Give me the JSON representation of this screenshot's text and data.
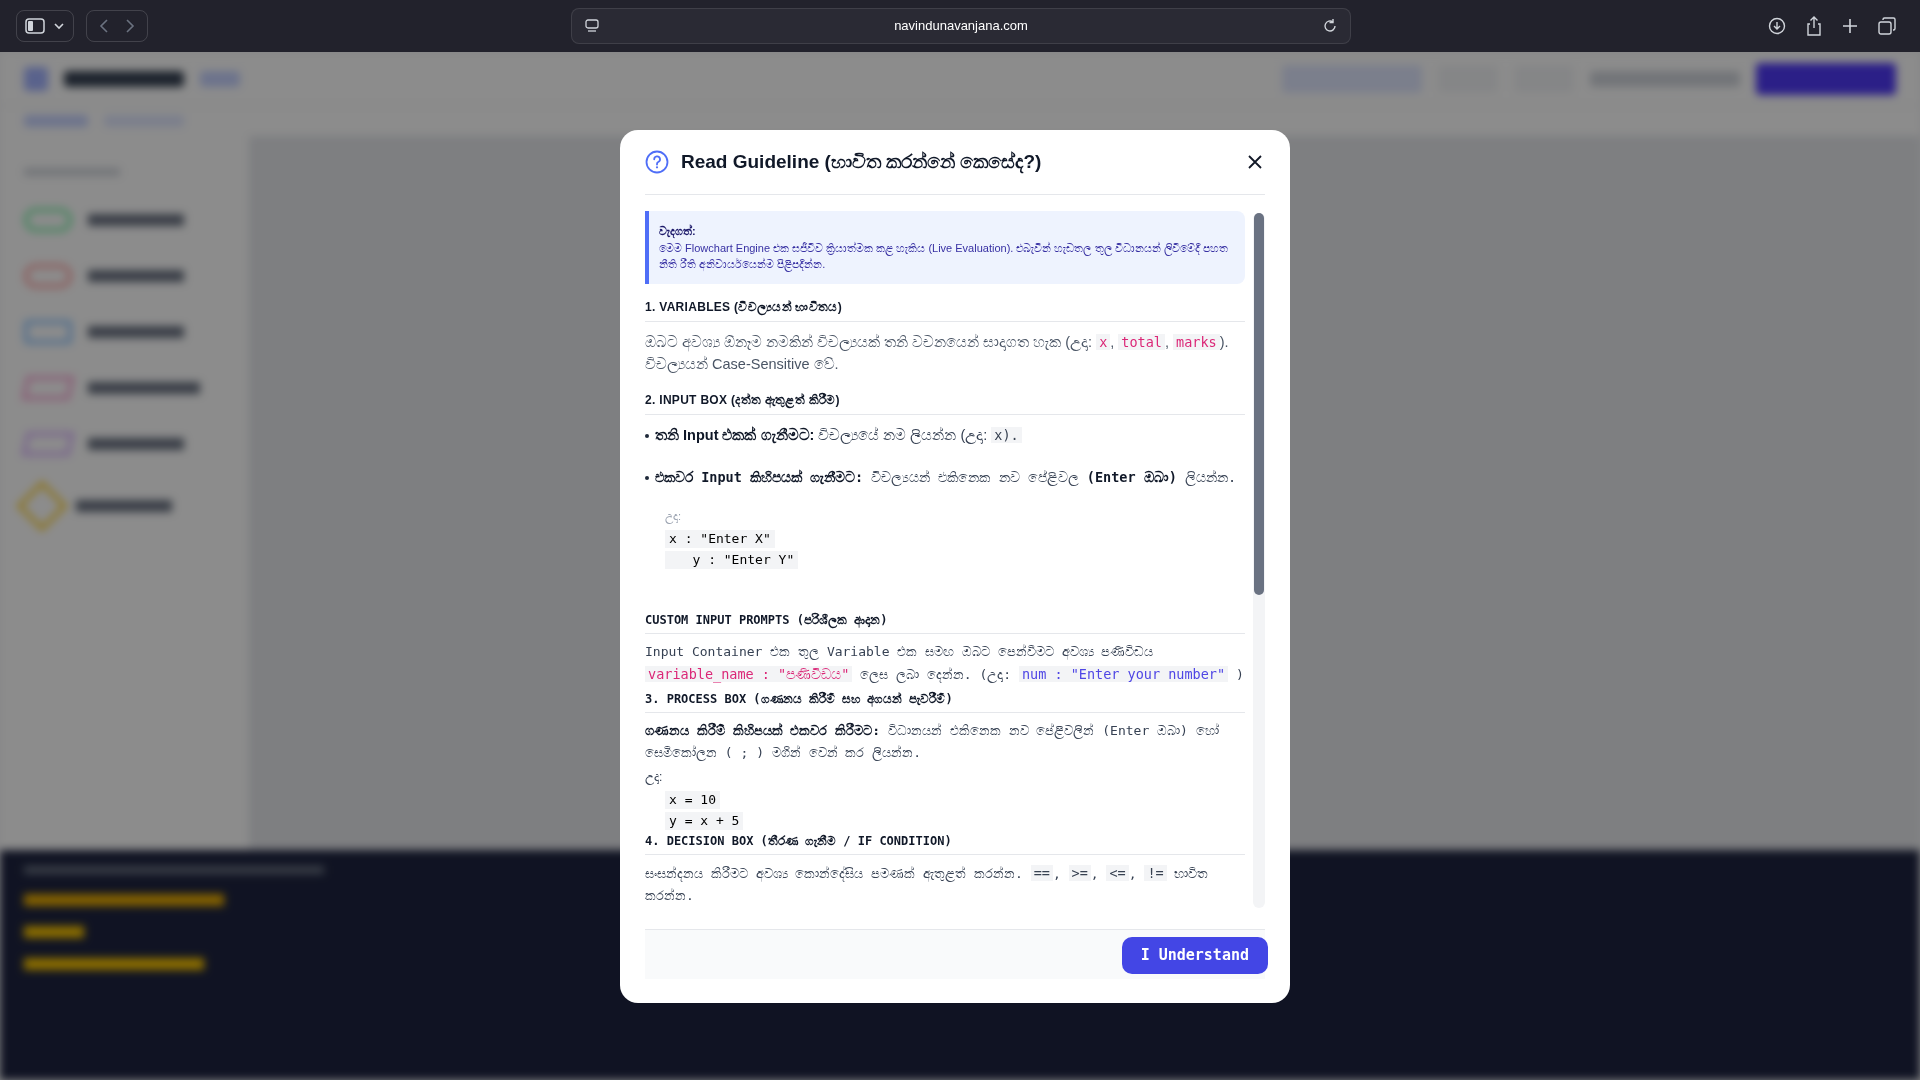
{
  "browser": {
    "url": "navindunavanjana.com"
  },
  "modal": {
    "title": "Read Guideline (භාවිත කරන්නේ කෙසේද?)",
    "note": {
      "heading": "වැදගත්:",
      "text": "මෙම Flowchart Engine එක සජීවීව ක්‍රියාත්මක කළ හැකිය (Live Evaluation). එබැවින් හැඩතල තුල විධානයන් ලිවීමේදී පහත නීති රීති අනිවාර්යයෙන්ම පිළිපදින්න."
    },
    "blocks": [
      {
        "kind": "heading",
        "text": "1. VARIABLES (විචල්‍යයන් භාවිතය)"
      },
      {
        "kind": "paragraph",
        "parts": [
          {
            "kind": "text",
            "text": "ඔබට අවශ්‍ය ඕනෑම නමකින් විචල්‍යයක් තනි වචනයෙන් සාදාගත හැක (උදා: "
          },
          {
            "kind": "code",
            "text": "x",
            "color": "#db2777"
          },
          {
            "kind": "text",
            "text": ", "
          },
          {
            "kind": "code",
            "text": "total",
            "color": "#db2777"
          },
          {
            "kind": "text",
            "text": ", "
          },
          {
            "kind": "code",
            "text": "marks",
            "color": "#db2777"
          },
          {
            "kind": "text",
            "text": "). විචල්‍යයන් Case-Sensitive වේ."
          }
        ]
      },
      {
        "kind": "heading",
        "text": "2. INPUT BOX (දත්ත ඇතුළත් කිරීම)"
      },
      {
        "kind": "bullet",
        "parts": [
          {
            "kind": "bold",
            "text": "තනි Input එකක් ගැනීමට:"
          },
          {
            "kind": "text",
            "text": " විචල්‍යයේ නම ලියන්න (උදා: "
          },
          {
            "kind": "code",
            "text": "x).",
            "color": "#374151"
          }
        ]
      },
      {
        "kind": "bullet-mono",
        "parts": [
          {
            "kind": "bold",
            "text": "එකවර Input කිහිපයක් ගැනීමට:"
          },
          {
            "kind": "text",
            "text": " විචල්‍යයන් එකිනෙක නව පේළිවල "
          },
          {
            "kind": "bold",
            "text": "(Enter ඔබා)"
          },
          {
            "kind": "text",
            "text": " ලියන්න."
          }
        ]
      },
      {
        "kind": "example-faint",
        "text": "උදා:"
      },
      {
        "kind": "code-lines",
        "lines": [
          "x : \"Enter X\"",
          "   y : \"Enter Y\""
        ]
      },
      {
        "kind": "heading-mono",
        "text": "CUSTOM INPUT PROMPTS (පරිශීලක ආදාන)"
      },
      {
        "kind": "paragraph-mono",
        "parts": [
          {
            "kind": "text",
            "text": "Input Container එක තුල Variable එක සමඟ ඔබට පෙන්වීමට අවශ්‍ය පණිවිඩය "
          },
          {
            "kind": "code",
            "text": "variable_name : \"පණිවිඩය\"",
            "color": "#db2777"
          },
          {
            "kind": "text",
            "text": " ලෙස ලබා දෙන්න. (උදා: "
          },
          {
            "kind": "code",
            "text": "num : \"Enter your number\"",
            "color": "#4f46e5"
          },
          {
            "kind": "text",
            "text": " )"
          }
        ]
      },
      {
        "kind": "heading-mono",
        "text": "3. PROCESS BOX (ගණනය කිරීම් සහ අගයන් පැවරීම්)"
      },
      {
        "kind": "paragraph-mono",
        "parts": [
          {
            "kind": "bold",
            "text": "ගණනය කිරීම් කිහිපයක් එකවර කිරීමට:"
          },
          {
            "kind": "text",
            "text": " විධානයන් එකිනෙක නව පේළිවලින් (Enter ඔබා) හෝ සෙමිකෝලන ( ; ) මගින් වෙන් කර ලියන්න."
          }
        ]
      },
      {
        "kind": "example",
        "text": "උදා:"
      },
      {
        "kind": "code-lines",
        "lines": [
          "x = 10",
          "y = x + 5"
        ]
      },
      {
        "kind": "heading-mono",
        "text": "4. DECISION BOX (තීරණ ගැනීම / IF CONDITION)"
      },
      {
        "kind": "paragraph-mono",
        "parts": [
          {
            "kind": "text",
            "text": "සංසන්දනය කිරීමට අවශ්‍ය කොන්දේසිය පමණක් ඇතුළත් කරන්න. "
          },
          {
            "kind": "code",
            "text": "==",
            "color": "#374151"
          },
          {
            "kind": "text",
            "text": ", "
          },
          {
            "kind": "code",
            "text": ">=",
            "color": "#374151"
          },
          {
            "kind": "text",
            "text": ", "
          },
          {
            "kind": "code",
            "text": "<=",
            "color": "#374151"
          },
          {
            "kind": "text",
            "text": ", "
          },
          {
            "kind": "code",
            "text": "!=",
            "color": "#374151"
          },
          {
            "kind": "text",
            "text": " භාවිත කරන්න."
          }
        ]
      }
    ],
    "button": "I Understand"
  }
}
